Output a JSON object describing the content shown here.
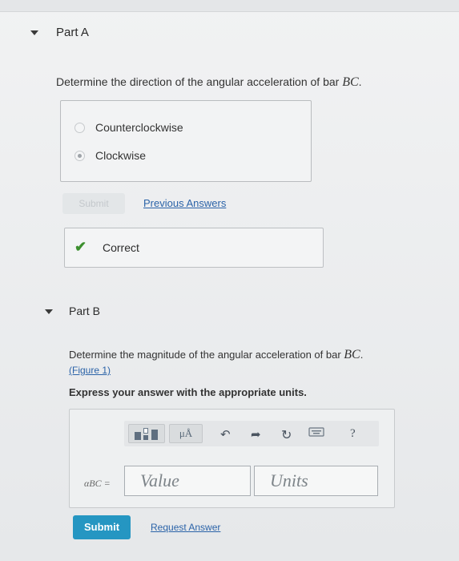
{
  "partA": {
    "title": "Part A",
    "question": "Determine the direction of the angular acceleration of bar ",
    "question_var": "BC",
    "question_end": ".",
    "choices": [
      {
        "label": "Counterclockwise",
        "selected": false
      },
      {
        "label": "Clockwise",
        "selected": true
      }
    ],
    "submit_label": "Submit",
    "previous_answers_link": "Previous Answers",
    "feedback": "Correct"
  },
  "partB": {
    "title": "Part B",
    "question": "Determine the magnitude of the angular acceleration of bar ",
    "question_var": "BC",
    "question_end": ".",
    "figure_link": "(Figure 1)",
    "instruction": "Express your answer with the appropriate units.",
    "toolbar": {
      "units_button": "μÅ",
      "help_button": "?"
    },
    "variable_label": "αBC =",
    "value_placeholder": "Value",
    "units_placeholder": "Units",
    "submit_label": "Submit",
    "request_answer_link": "Request Answer"
  },
  "colors": {
    "accent": "#2596c2",
    "link": "#2b63a8",
    "correct": "#3c8f2e"
  }
}
